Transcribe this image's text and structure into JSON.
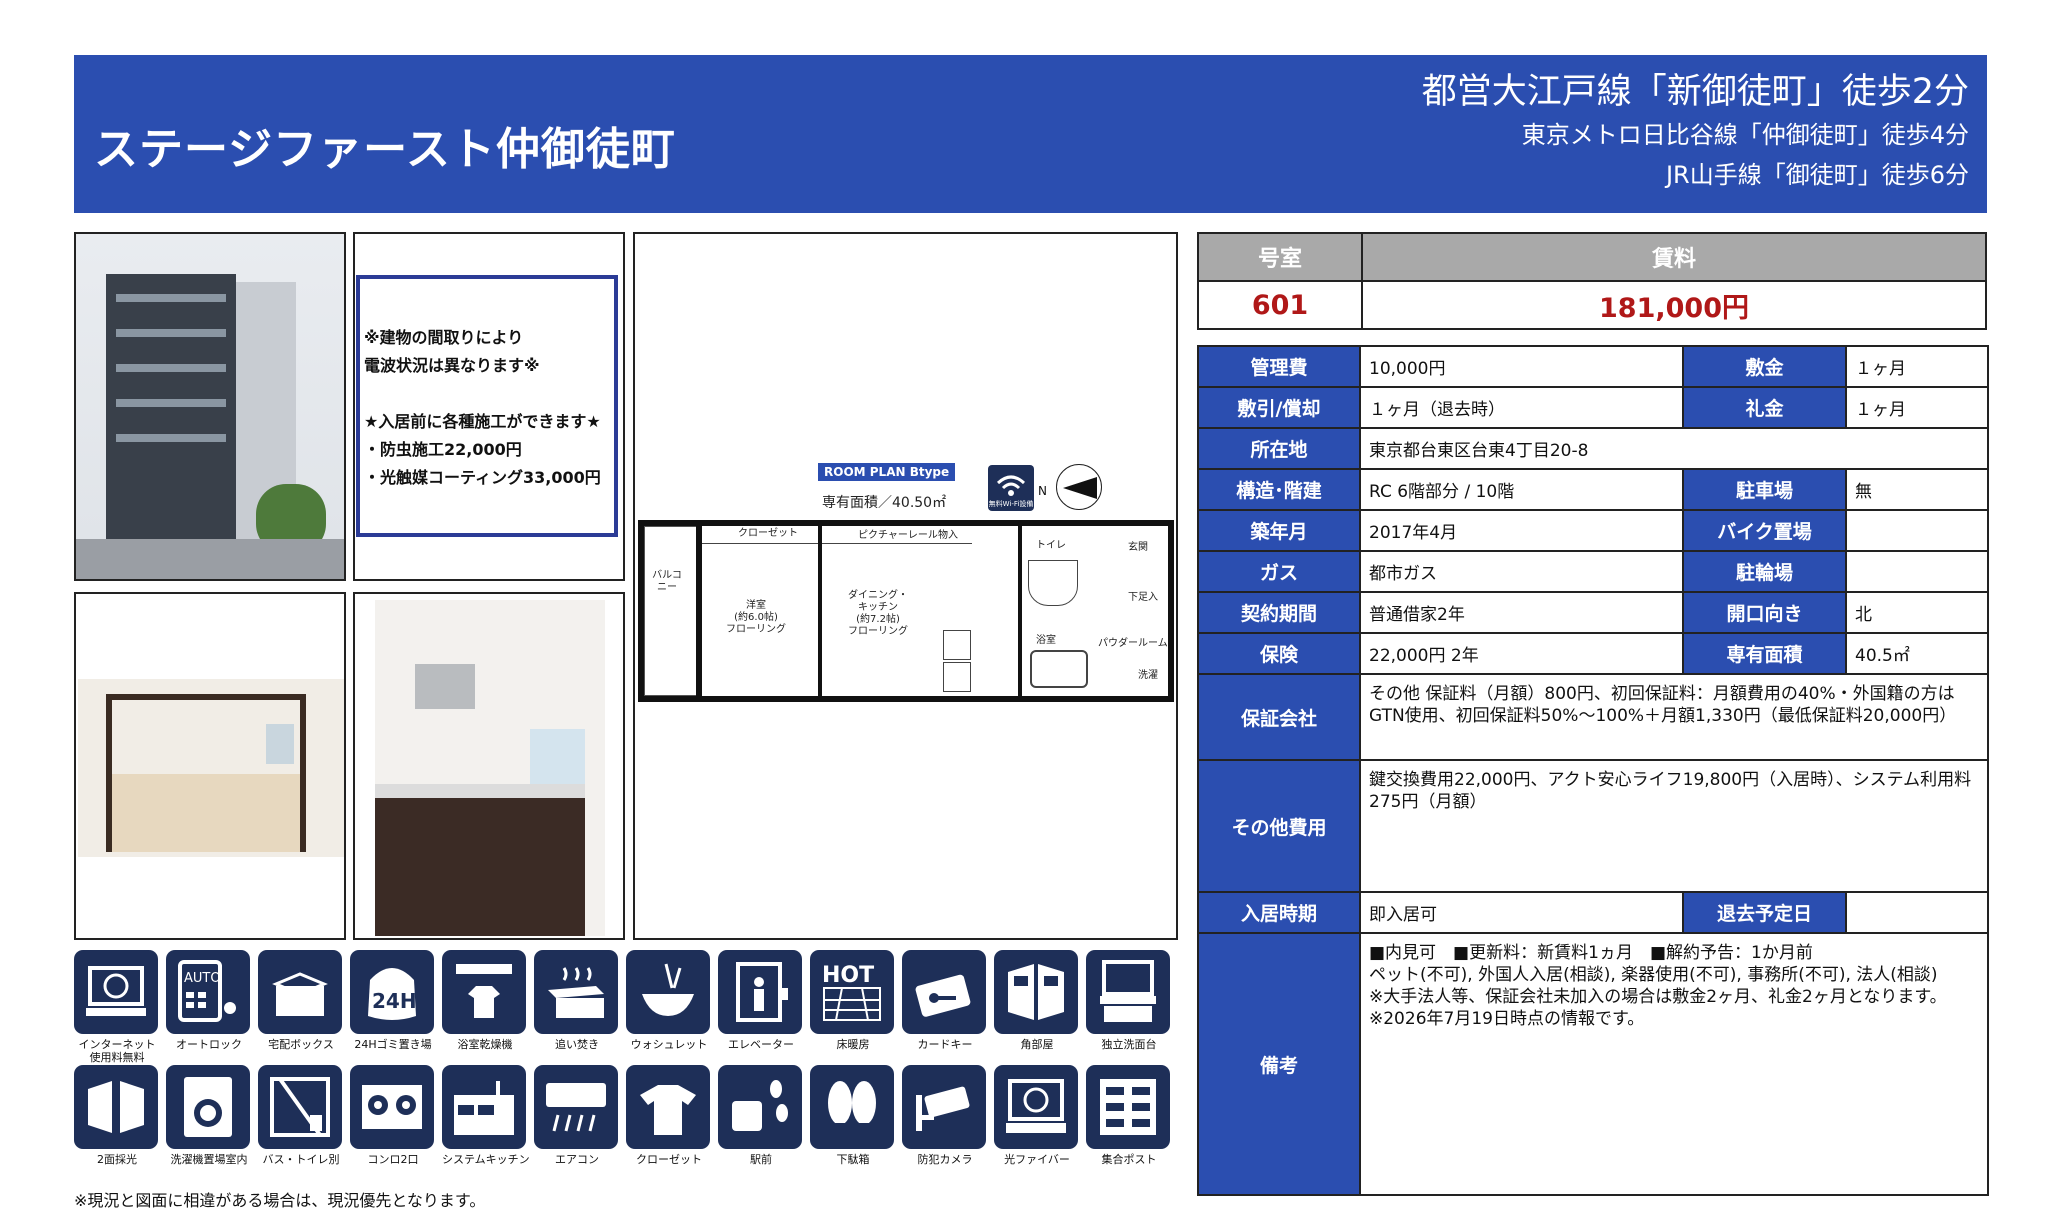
{
  "header": {
    "property_name": "ステージファースト仲御徒町",
    "access_primary": "都営大江戸線「新御徒町」徒歩2分",
    "access_2": "東京メトロ日比谷線「仲御徒町」徒歩4分",
    "access_3": "JR山手線「御徒町」徒歩6分"
  },
  "notice": {
    "line1": "※建物の間取りにより",
    "line2": "電波状況は異なります※",
    "line3": "★入居前に各種施工ができます★",
    "line4": "・防虫施工22,000円",
    "line5": "・光触媒コーティング33,000円"
  },
  "floorplan": {
    "tag": "ROOM PLAN Btype",
    "area": "専有面積／40.50㎡",
    "wifi": "無料Wi-Fi設備",
    "north": "N",
    "closet": "クローゼット",
    "picture_rail": "ピクチャーレール",
    "storage": "物入",
    "toilet": "トイレ",
    "entrance": "玄関",
    "balcony": "バルコニー",
    "western_room": "洋室\n(約6.0帖)\nフローリング",
    "dining_kitchen": "ダイニング・\nキッチン\n(約7.2帖)\nフローリング",
    "shoe_box": "下足入",
    "bath": "浴室",
    "powder_room": "パウダールーム",
    "washer": "洗濯"
  },
  "amenities": [
    {
      "label": "インターネット\n使用料無料",
      "icon": "internet-icon"
    },
    {
      "label": "オートロック",
      "icon": "autolock-icon"
    },
    {
      "label": "宅配ボックス",
      "icon": "delivery-box-icon"
    },
    {
      "label": "24Hゴミ置き場",
      "icon": "garbage-24h-icon"
    },
    {
      "label": "浴室乾燥機",
      "icon": "bath-dryer-icon"
    },
    {
      "label": "追い焚き",
      "icon": "reheat-bath-icon"
    },
    {
      "label": "ウォシュレット",
      "icon": "washlet-icon"
    },
    {
      "label": "エレベーター",
      "icon": "elevator-icon"
    },
    {
      "label": "床暖房",
      "icon": "floor-heating-icon"
    },
    {
      "label": "カードキー",
      "icon": "card-key-icon"
    },
    {
      "label": "角部屋",
      "icon": "corner-room-icon"
    },
    {
      "label": "独立洗面台",
      "icon": "vanity-icon"
    },
    {
      "label": "2面採光",
      "icon": "two-side-light-icon"
    },
    {
      "label": "洗濯機置場室内",
      "icon": "indoor-washer-icon"
    },
    {
      "label": "バス・トイレ別",
      "icon": "separate-bath-toilet-icon"
    },
    {
      "label": "コンロ2口",
      "icon": "two-burner-icon"
    },
    {
      "label": "システムキッチン",
      "icon": "system-kitchen-icon"
    },
    {
      "label": "エアコン",
      "icon": "air-conditioner-icon"
    },
    {
      "label": "クローゼット",
      "icon": "closet-icon"
    },
    {
      "label": "駅前",
      "icon": "station-front-icon"
    },
    {
      "label": "下駄箱",
      "icon": "shoe-box-icon"
    },
    {
      "label": "防犯カメラ",
      "icon": "security-camera-icon"
    },
    {
      "label": "光ファイバー",
      "icon": "fiber-optic-icon"
    },
    {
      "label": "集合ポスト",
      "icon": "mailbox-icon"
    }
  ],
  "amenity_badges": {
    "autolock": "AUTO",
    "garbage": "24H",
    "floor_heating": "HOT"
  },
  "footnote": "※現況と図面に相違がある場合は、現況優先となります。",
  "rent": {
    "room_header": "号室",
    "rent_header": "賃料",
    "room": "601",
    "price": "181,000円"
  },
  "info": {
    "mgmt_label": "管理費",
    "mgmt": "10,000円",
    "deposit_label": "敷金",
    "deposit": "１ヶ月",
    "offset_label": "敷引/償却",
    "offset": "１ヶ月（退去時）",
    "key_money_label": "礼金",
    "key_money": "１ヶ月",
    "address_label": "所在地",
    "address": "東京都台東区台東4丁目20-8",
    "structure_label": "構造･階建",
    "structure": "RC 6階部分 / 10階",
    "parking_label": "駐車場",
    "parking": "無",
    "built_label": "築年月",
    "built": "2017年4月",
    "bike_label": "バイク置場",
    "bike": "",
    "gas_label": "ガス",
    "gas": "都市ガス",
    "bicycle_label": "駐輪場",
    "bicycle": "",
    "contract_label": "契約期間",
    "contract": "普通借家2年",
    "orientation_label": "開口向き",
    "orientation": "北",
    "insurance_label": "保険",
    "insurance": "22,000円 2年",
    "area_label": "専有面積",
    "area": "40.5㎡",
    "guarantor_label": "保証会社",
    "guarantor": "その他 保証料（月額）800円、初回保証料：月額費用の40%・外国籍の方はGTN使用、初回保証料50%～100%＋月額1,330円（最低保証料20,000円）",
    "other_fees_label": "その他費用",
    "other_fees": "鍵交換費用22,000円、アクト安心ライフ19,800円（入居時）、システム利用料275円（月額）",
    "move_in_label": "入居時期",
    "move_in": "即入居可",
    "move_out_label": "退去予定日",
    "move_out": "",
    "remarks_label": "備考",
    "remarks_1": "■内見可　■更新料：新賃料1ヵ月　■解約予告：1か月前",
    "remarks_2": "ペット(不可), 外国人入居(相談), 楽器使用(不可), 事務所(不可), 法人(相談)",
    "remarks_3": "※大手法人等、保証会社未加入の場合は敷金2ヶ月、礼金2ヶ月となります。",
    "remarks_4": "※2026年7月19日時点の情報です。"
  },
  "colors": {
    "header_blue": "#2b4eb0",
    "icon_navy": "#1e2f58",
    "price_red": "#b01818",
    "gray_header": "#a9a9a9"
  }
}
